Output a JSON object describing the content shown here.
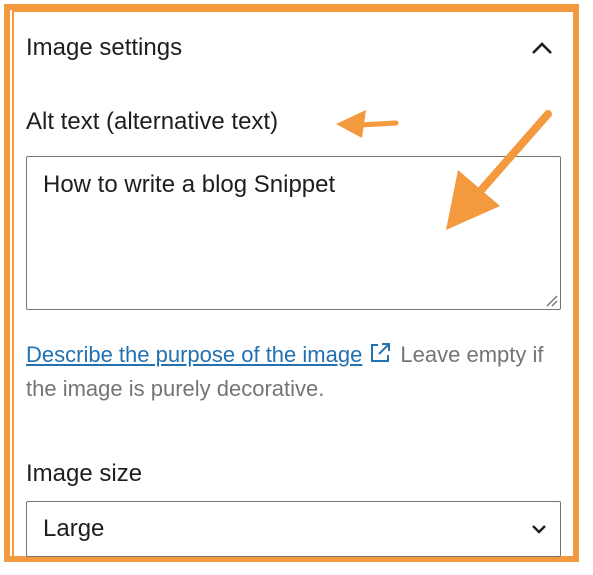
{
  "panel": {
    "title": "Image settings",
    "toggle_icon": "chevron-up-icon"
  },
  "alt_text": {
    "label": "Alt text (alternative text)",
    "value": "How to write a blog Snippet"
  },
  "help": {
    "link_text": "Describe the purpose of the image",
    "link_icon": "external-link-icon",
    "trailing_text": " Leave empty if the image is purely decorative."
  },
  "image_size": {
    "label": "Image size",
    "selected": "Large",
    "dropdown_icon": "chevron-down-icon"
  },
  "colors": {
    "annotation": "#f3993e",
    "link": "#2271b1",
    "muted_text": "#757575"
  }
}
